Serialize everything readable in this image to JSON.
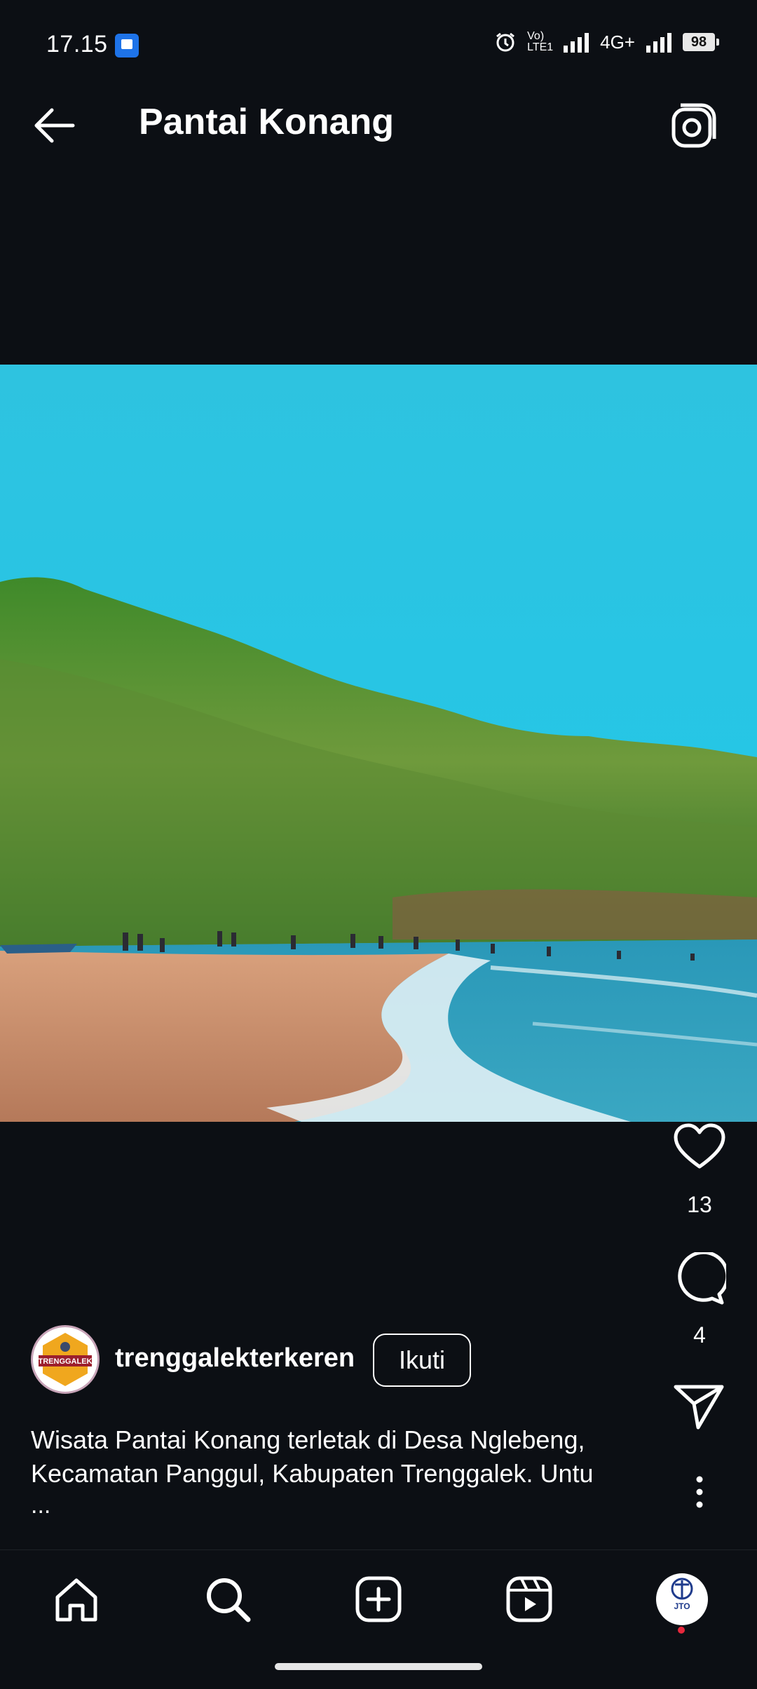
{
  "status_bar": {
    "time": "17.15",
    "network": "4G+",
    "volte": "Vo) LTE1",
    "battery": "98"
  },
  "header": {
    "title": "Pantai Konang"
  },
  "post": {
    "likes": "13",
    "comments": "4",
    "author": {
      "username": "trenggalekterkeren",
      "avatar_text": "TRENGGALEK",
      "follow_label": "Ikuti"
    },
    "caption": "Wisata Pantai Konang terletak di Desa Nglebeng, Kecamatan Panggul, Kabupaten Trenggalek. Untu",
    "more_label": "..."
  },
  "bottom_nav": {
    "profile_avatar_text": "JTO"
  },
  "colors": {
    "background": "#0c0f14",
    "sky": "#22c6e4",
    "sand": "#c98f6b",
    "sea": "#2f9fbf",
    "notification_dot": "#e8283c"
  },
  "icons": [
    "back-arrow-icon",
    "camera-icon",
    "heart-icon",
    "comment-icon",
    "share-icon",
    "more-vertical-icon",
    "home-icon",
    "search-icon",
    "add-post-icon",
    "reels-icon"
  ]
}
